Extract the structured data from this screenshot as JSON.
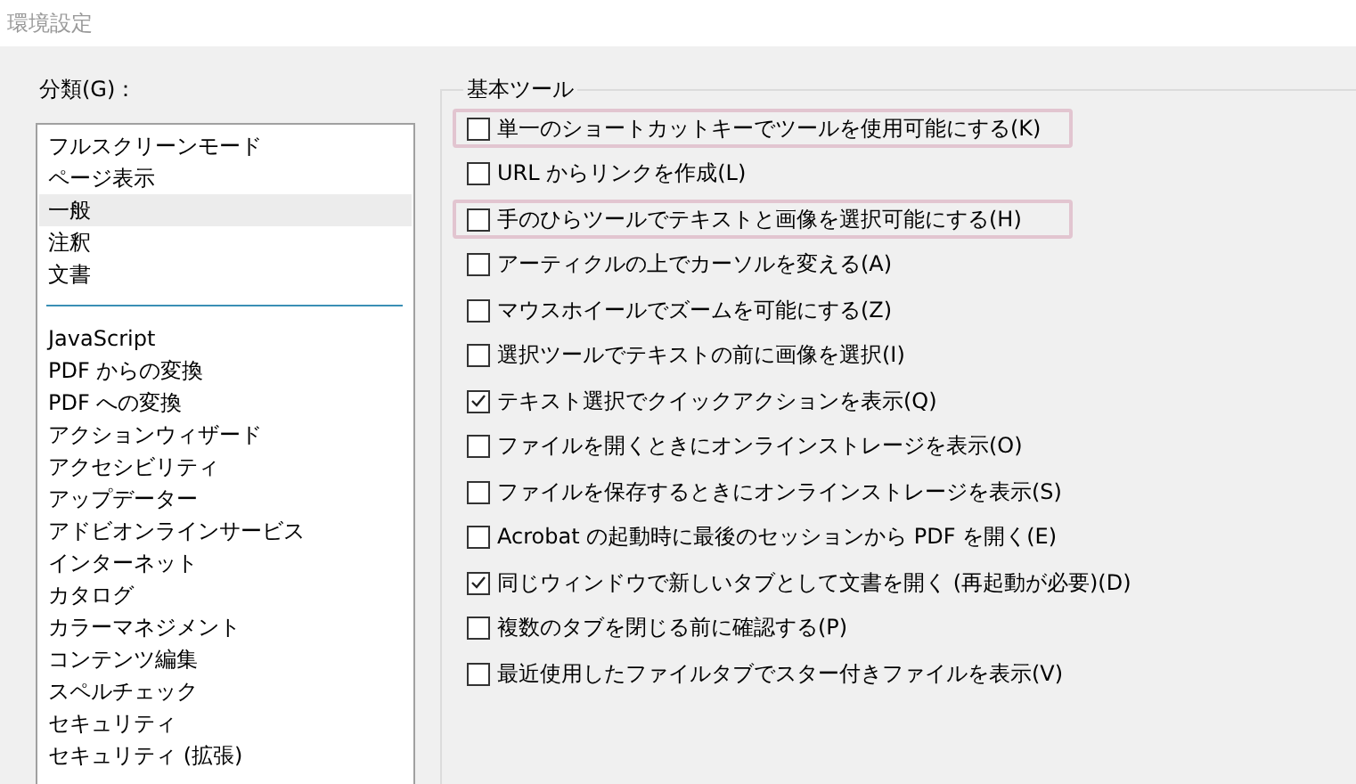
{
  "window": {
    "title": "環境設定"
  },
  "categories": {
    "label": "分類(G)：",
    "groups": [
      [
        {
          "label": "フルスクリーンモード",
          "selected": false
        },
        {
          "label": "ページ表示",
          "selected": false
        },
        {
          "label": "一般",
          "selected": true
        },
        {
          "label": "注釈",
          "selected": false
        },
        {
          "label": "文書",
          "selected": false
        }
      ],
      [
        {
          "label": "JavaScript",
          "selected": false
        },
        {
          "label": "PDF からの変換",
          "selected": false
        },
        {
          "label": "PDF への変換",
          "selected": false
        },
        {
          "label": "アクションウィザード",
          "selected": false
        },
        {
          "label": "アクセシビリティ",
          "selected": false
        },
        {
          "label": "アップデーター",
          "selected": false
        },
        {
          "label": "アドビオンラインサービス",
          "selected": false
        },
        {
          "label": "インターネット",
          "selected": false
        },
        {
          "label": "カタログ",
          "selected": false
        },
        {
          "label": "カラーマネジメント",
          "selected": false
        },
        {
          "label": "コンテンツ編集",
          "selected": false
        },
        {
          "label": "スペルチェック",
          "selected": false
        },
        {
          "label": "セキュリティ",
          "selected": false
        },
        {
          "label": "セキュリティ (拡張)",
          "selected": false
        }
      ]
    ]
  },
  "basic_tools": {
    "title": "基本ツール",
    "options": [
      {
        "label": "単一のショートカットキーでツールを使用可能にする(K)",
        "checked": false,
        "highlighted": true
      },
      {
        "label": "URL からリンクを作成(L)",
        "checked": false,
        "highlighted": false
      },
      {
        "label": "手のひらツールでテキストと画像を選択可能にする(H)",
        "checked": false,
        "highlighted": true
      },
      {
        "label": "アーティクルの上でカーソルを変える(A)",
        "checked": false,
        "highlighted": false
      },
      {
        "label": "マウスホイールでズームを可能にする(Z)",
        "checked": false,
        "highlighted": false
      },
      {
        "label": "選択ツールでテキストの前に画像を選択(I)",
        "checked": false,
        "highlighted": false
      },
      {
        "label": "テキスト選択でクイックアクションを表示(Q)",
        "checked": true,
        "highlighted": false
      },
      {
        "label": "ファイルを開くときにオンラインストレージを表示(O)",
        "checked": false,
        "highlighted": false
      },
      {
        "label": "ファイルを保存するときにオンラインストレージを表示(S)",
        "checked": false,
        "highlighted": false
      },
      {
        "label": "Acrobat の起動時に最後のセッションから PDF を開く(E)",
        "checked": false,
        "highlighted": false
      },
      {
        "label": "同じウィンドウで新しいタブとして文書を開く (再起動が必要)(D)",
        "checked": true,
        "highlighted": false
      },
      {
        "label": "複数のタブを閉じる前に確認する(P)",
        "checked": false,
        "highlighted": false
      },
      {
        "label": "最近使用したファイルタブでスター付きファイルを表示(V)",
        "checked": false,
        "highlighted": false
      }
    ]
  }
}
